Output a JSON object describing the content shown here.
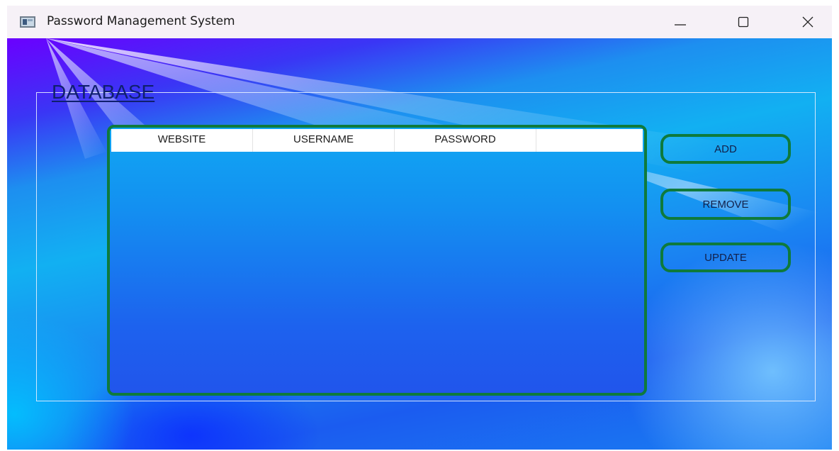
{
  "window": {
    "title": "Password Management System",
    "icon": "app-window-icon",
    "controls": {
      "minimize_icon": "minimize-icon",
      "maximize_icon": "maximize-icon",
      "close_icon": "close-icon"
    }
  },
  "database": {
    "legend": "DATABASE",
    "table": {
      "columns": [
        "WEBSITE",
        "USERNAME",
        "PASSWORD",
        ""
      ],
      "rows": []
    }
  },
  "actions": {
    "add_label": "ADD",
    "remove_label": "REMOVE",
    "update_label": "UPDATE"
  },
  "colors": {
    "button_border": "#0e7a3c",
    "table_border": "#0e7a3c",
    "legend_text": "#0f1f6e",
    "background_purple": "#6b00ff",
    "background_blue": "#12b0f2"
  }
}
